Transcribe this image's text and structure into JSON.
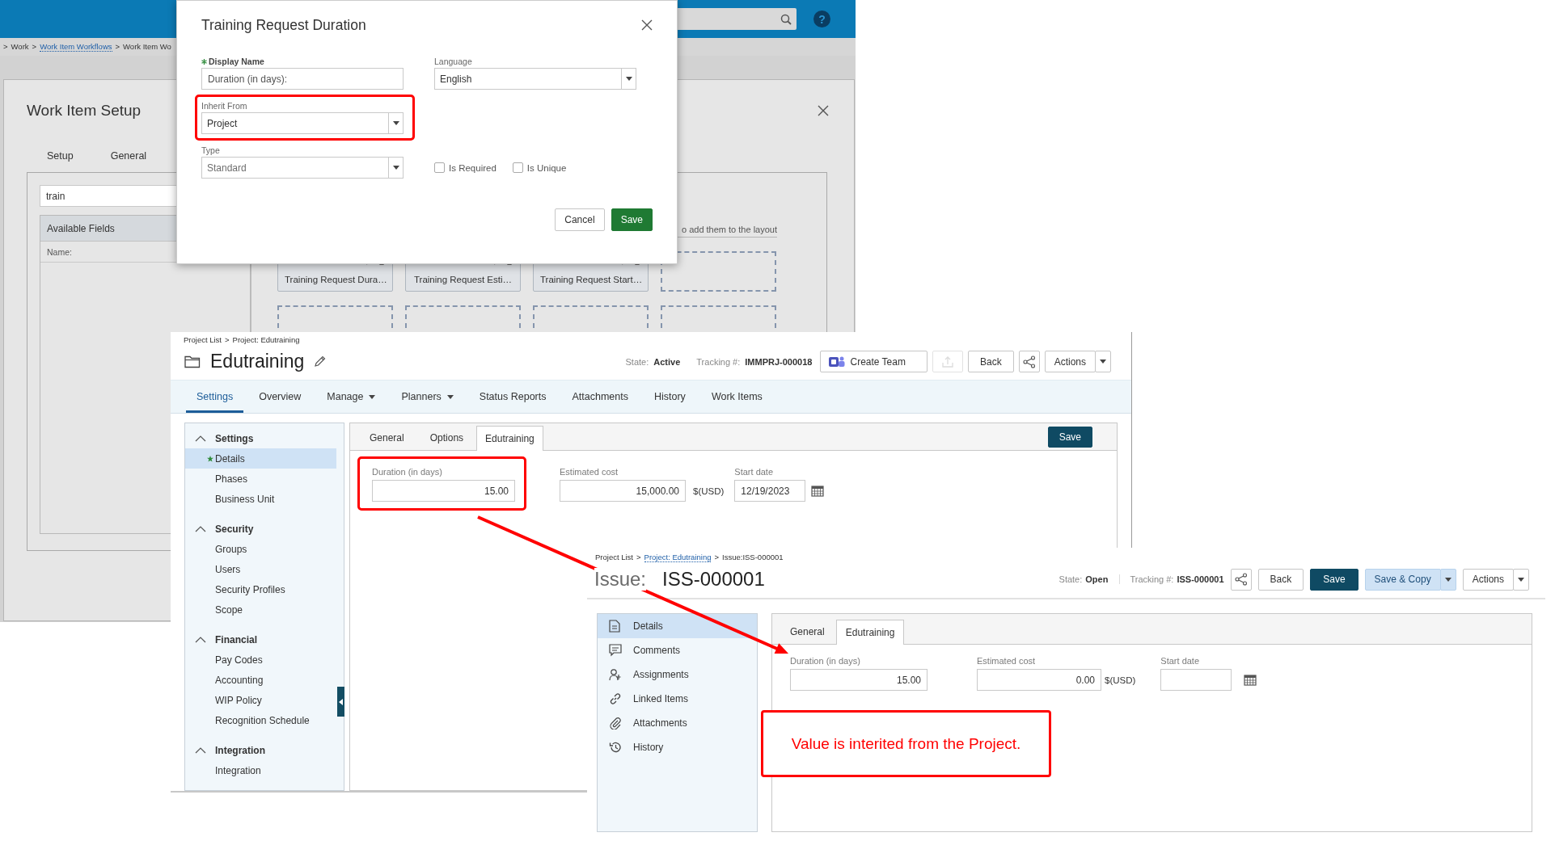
{
  "work_item_app": {
    "help": "?",
    "breadcrumb": {
      "separator": ">",
      "items": [
        {
          "text": "Work",
          "link": false
        },
        {
          "text": "Work Item Workflows",
          "link": true
        },
        {
          "text": "Work Item Wo",
          "link": false
        }
      ]
    },
    "setup_dialog": {
      "title": "Work Item Setup",
      "tabs": [
        {
          "label": "Setup",
          "selected": false
        },
        {
          "label": "General",
          "selected": false
        }
      ],
      "search_value": "train",
      "available_fields": {
        "header": "Available Fields",
        "column": "Name:"
      },
      "layout_hint": "o add them to the layout",
      "layout_slots": [
        {
          "kind": "field",
          "label": "Training Request Dura…"
        },
        {
          "kind": "field",
          "label": "Training Request Esti…"
        },
        {
          "kind": "field",
          "label": "Training Request Start…"
        },
        {
          "kind": "empty"
        },
        {
          "kind": "empty"
        },
        {
          "kind": "empty"
        },
        {
          "kind": "empty"
        },
        {
          "kind": "empty"
        }
      ]
    }
  },
  "field_dialog": {
    "title": "Training Request Duration",
    "left_fields": [
      {
        "kind": "text",
        "label": "Display Name",
        "value": "Duration (in days):",
        "required": true,
        "disabled": false,
        "highlighted": false
      },
      {
        "kind": "select",
        "label": "Inherit From",
        "value": "Project",
        "required": false,
        "disabled": false,
        "highlighted": true
      },
      {
        "kind": "select",
        "label": "Type",
        "value": "Standard",
        "required": false,
        "disabled": true,
        "highlighted": false
      }
    ],
    "right_fields": [
      {
        "kind": "select",
        "label": "Language",
        "value": "English",
        "required": false,
        "disabled": false,
        "highlighted": false
      }
    ],
    "checkboxes": [
      {
        "label": "Is Required",
        "checked": false
      },
      {
        "label": "Is Unique",
        "checked": false
      }
    ],
    "buttons": [
      {
        "kind": "secondary",
        "label": "Cancel"
      },
      {
        "kind": "primary",
        "label": "Save"
      }
    ]
  },
  "project_window": {
    "separator": ">",
    "breadcrumb": [
      {
        "text": "Project List",
        "link": false
      },
      {
        "text": "Project: Edutraining",
        "link": false
      }
    ],
    "title": "Edutraining",
    "state_label": "State:",
    "state": "Active",
    "tracking_label": "Tracking #:",
    "tracking": "IMMPRJ-000018",
    "toolbar": [
      {
        "kind": "teams",
        "label": "Create Team",
        "disabled": false
      },
      {
        "kind": "upload",
        "disabled": true
      },
      {
        "kind": "back",
        "label": "Back",
        "disabled": false
      },
      {
        "kind": "share",
        "disabled": false
      },
      {
        "kind": "dropdown",
        "label": "Actions",
        "disabled": false
      }
    ],
    "nav": [
      {
        "label": "Settings",
        "selected": true,
        "menu": false
      },
      {
        "label": "Overview",
        "selected": false,
        "menu": false
      },
      {
        "label": "Manage",
        "selected": false,
        "menu": true
      },
      {
        "label": "Planners",
        "selected": false,
        "menu": true
      },
      {
        "label": "Status Reports",
        "selected": false,
        "menu": false
      },
      {
        "label": "Attachments",
        "selected": false,
        "menu": false
      },
      {
        "label": "History",
        "selected": false,
        "menu": false
      },
      {
        "label": "Work Items",
        "selected": false,
        "menu": false
      }
    ],
    "sidebar": [
      {
        "title": "Settings",
        "expanded": true,
        "items": [
          {
            "label": "Details",
            "selected": true,
            "starred": true
          },
          {
            "label": "Phases",
            "selected": false,
            "starred": false
          },
          {
            "label": "Business Unit",
            "selected": false,
            "starred": false
          }
        ]
      },
      {
        "title": "Security",
        "expanded": true,
        "items": [
          {
            "label": "Groups",
            "selected": false,
            "starred": false
          },
          {
            "label": "Users",
            "selected": false,
            "starred": false
          },
          {
            "label": "Security Profiles",
            "selected": false,
            "starred": false
          },
          {
            "label": "Scope",
            "selected": false,
            "starred": false
          }
        ]
      },
      {
        "title": "Financial",
        "expanded": true,
        "items": [
          {
            "label": "Pay Codes",
            "selected": false,
            "starred": false
          },
          {
            "label": "Accounting",
            "selected": false,
            "starred": false
          },
          {
            "label": "WIP Policy",
            "selected": false,
            "starred": false
          },
          {
            "label": "Recognition Schedule",
            "selected": false,
            "starred": false
          }
        ]
      },
      {
        "title": "Integration",
        "expanded": true,
        "items": [
          {
            "label": "Integration",
            "selected": false,
            "starred": false
          }
        ]
      }
    ],
    "tabs": [
      {
        "label": "General",
        "selected": false
      },
      {
        "label": "Options",
        "selected": false
      },
      {
        "label": "Edutraining",
        "selected": true
      }
    ],
    "save_button": "Save",
    "fields": [
      {
        "kind": "number",
        "label": "Duration (in days)",
        "value": "15.00",
        "highlighted": true
      },
      {
        "kind": "currency",
        "label": "Estimated cost",
        "value": "15,000.00",
        "suffix": "$(USD)",
        "highlighted": false
      },
      {
        "kind": "date",
        "label": "Start date",
        "value": "12/19/2023",
        "highlighted": false
      }
    ]
  },
  "issue_window": {
    "separator": ">",
    "breadcrumb": [
      {
        "text": "Project List",
        "link": false
      },
      {
        "text": "Project: Edutraining",
        "link": true
      },
      {
        "text": "Issue:ISS-000001",
        "link": false
      }
    ],
    "title_prefix": "Issue:",
    "title": "ISS-000001",
    "state_label": "State:",
    "state": "Open",
    "tracking_label": "Tracking #:",
    "tracking": "ISS-000001",
    "toolbar": [
      {
        "kind": "share",
        "disabled": false
      },
      {
        "kind": "back",
        "label": "Back",
        "disabled": false
      },
      {
        "kind": "primary",
        "label": "Save",
        "disabled": false
      },
      {
        "kind": "split",
        "label": "Save & Copy",
        "disabled": false
      },
      {
        "kind": "dropdown",
        "label": "Actions",
        "disabled": false
      }
    ],
    "sidebar": [
      {
        "kind": "document",
        "label": "Details",
        "selected": true
      },
      {
        "kind": "comment",
        "label": "Comments",
        "selected": false
      },
      {
        "kind": "assignment",
        "label": "Assignments",
        "selected": false
      },
      {
        "kind": "link",
        "label": "Linked Items",
        "selected": false
      },
      {
        "kind": "attachment",
        "label": "Attachments",
        "selected": false
      },
      {
        "kind": "history",
        "label": "History",
        "selected": false
      }
    ],
    "tabs": [
      {
        "label": "General",
        "selected": false
      },
      {
        "label": "Edutraining",
        "selected": true
      }
    ],
    "fields": [
      {
        "kind": "number",
        "label": "Duration (in days)",
        "value": "15.00",
        "highlighted": false
      },
      {
        "kind": "currency",
        "label": "Estimated cost",
        "value": "0.00",
        "suffix": "$(USD)",
        "highlighted": false
      },
      {
        "kind": "date",
        "label": "Start date",
        "highlighted": false
      }
    ]
  },
  "annotation": {
    "callout": "Value is interited from the Project."
  }
}
